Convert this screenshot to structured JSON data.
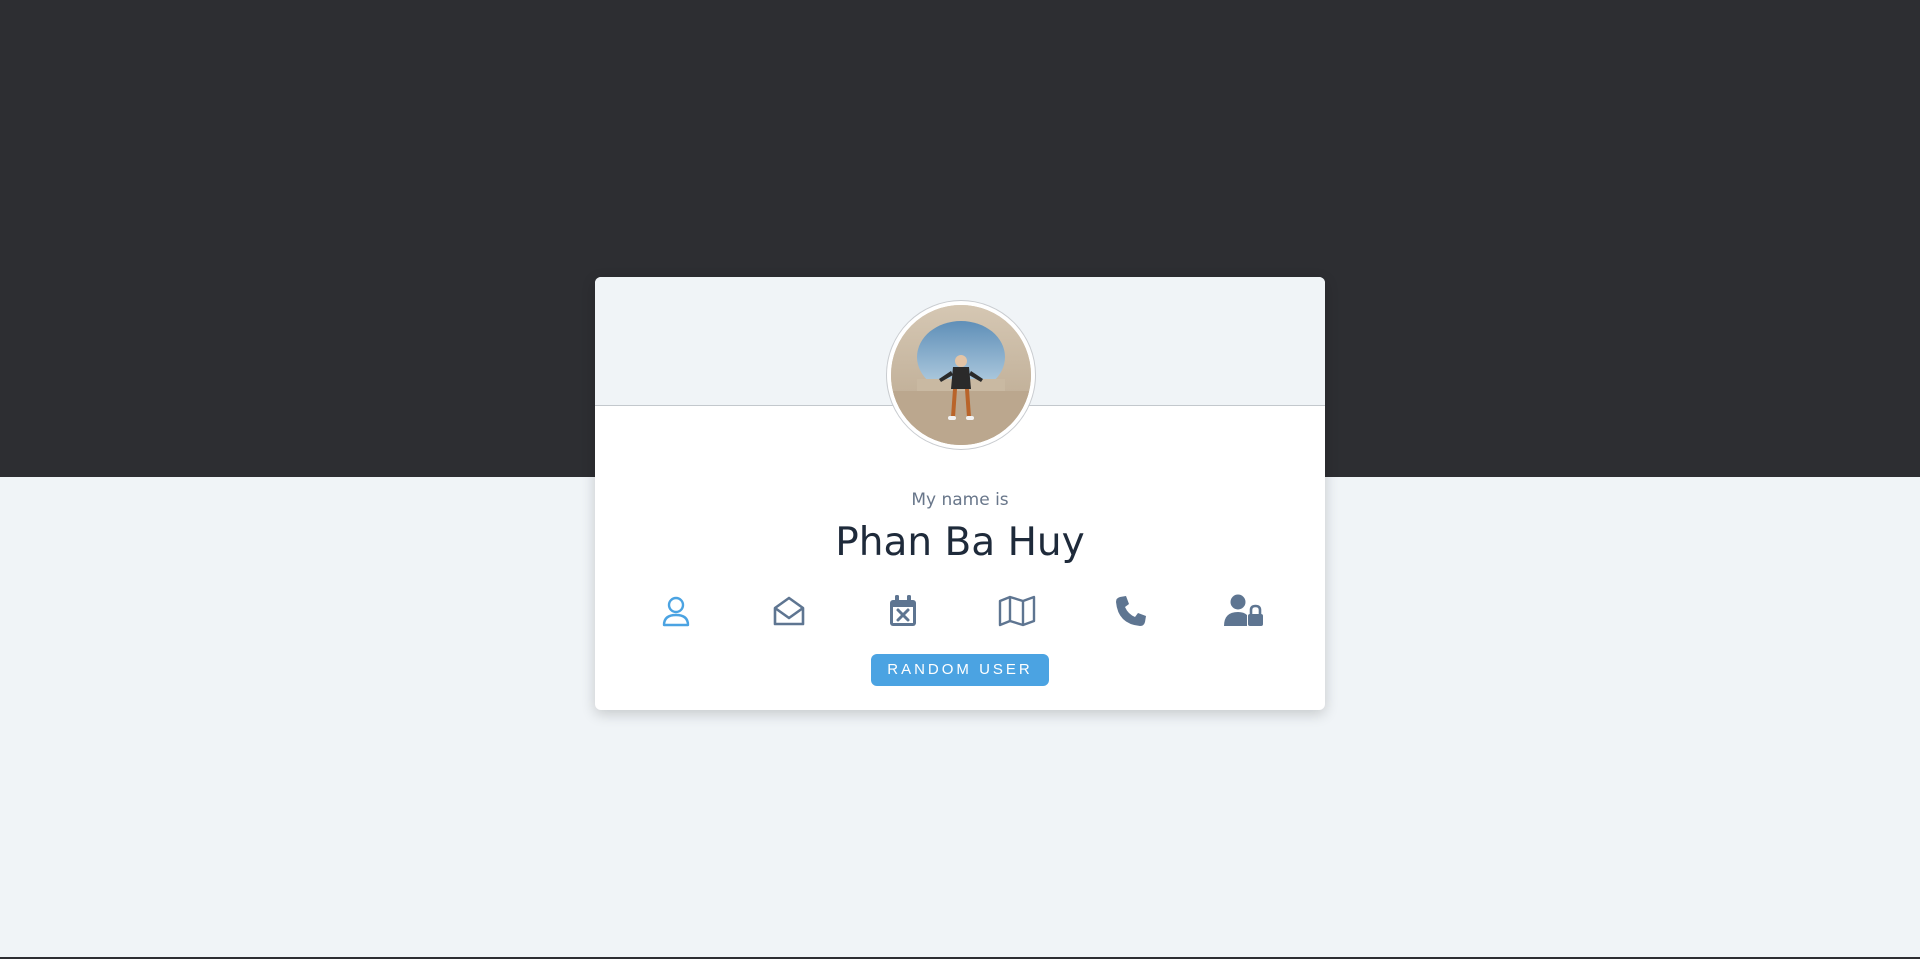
{
  "profile": {
    "greeting": "My name is",
    "name": "Phan Ba Huy"
  },
  "info_tabs": [
    {
      "icon": "user-icon",
      "active": true
    },
    {
      "icon": "envelope-open-icon",
      "active": false
    },
    {
      "icon": "calendar-x-icon",
      "active": false
    },
    {
      "icon": "map-icon",
      "active": false
    },
    {
      "icon": "phone-icon",
      "active": false
    },
    {
      "icon": "user-lock-icon",
      "active": false
    }
  ],
  "actions": {
    "random_user_label": "RANDOM USER"
  },
  "colors": {
    "dark_band": "#2d2e32",
    "page_background": "#f0f4f7",
    "accent": "#4ba3e2",
    "icon_default": "#5e7591",
    "name_text": "#1e2a3a",
    "greeting_text": "#68768a"
  }
}
